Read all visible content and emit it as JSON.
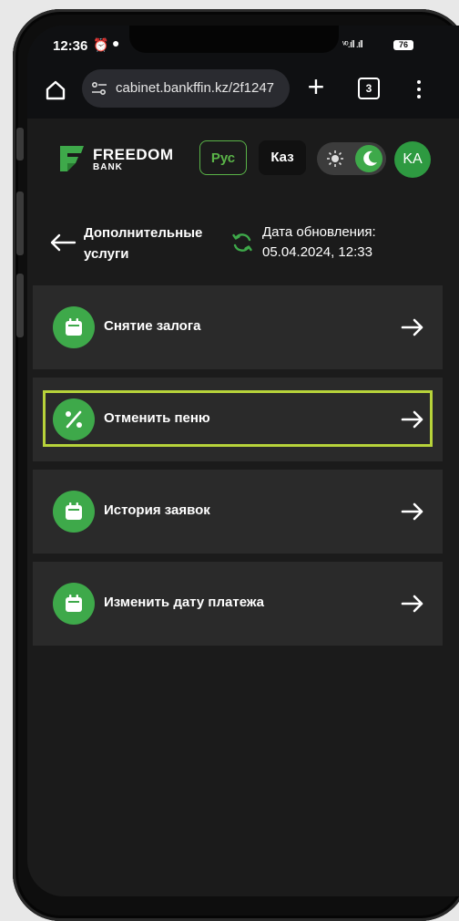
{
  "status_bar": {
    "time": "12:36",
    "signal": "ᵛᵒ.ıll .ıll",
    "battery": "76"
  },
  "browser": {
    "url": "cabinet.bankffin.kz/2f1247",
    "tab_count": "3"
  },
  "header": {
    "brand_name": "FREEDOM",
    "brand_sub": "BANK",
    "lang_ru": "Рус",
    "lang_kz": "Каз",
    "avatar_initials": "KA"
  },
  "page": {
    "title": "Дополнительные услуги",
    "update_label": "Дата обновления:",
    "update_date": "05.04.2024, 12:33"
  },
  "services": [
    {
      "label": "Снятие залога",
      "icon": "calendar-icon"
    },
    {
      "label": "Отменить пеню",
      "icon": "percent-icon"
    },
    {
      "label": "История заявок",
      "icon": "calendar-icon"
    },
    {
      "label": "Изменить дату платежа",
      "icon": "calendar-icon"
    }
  ],
  "colors": {
    "accent_green": "#3ea94a",
    "highlight": "#b7d33a",
    "background": "#1b1b1b",
    "card": "#2a2a2a"
  }
}
